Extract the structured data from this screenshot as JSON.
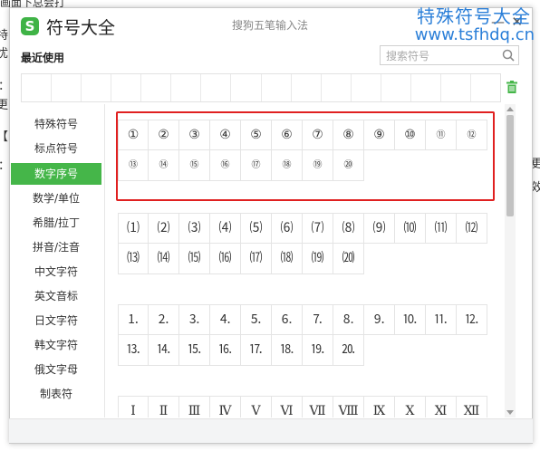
{
  "background": {
    "top_fragment": "画面下总会打",
    "left_fragments": [
      "特",
      "忧",
      "：",
      "更",
      "【",
      "："
    ],
    "right_fragments": [
      "更",
      "效"
    ]
  },
  "watermark": {
    "line1": "特殊符号大全",
    "line2": "www.tsfhdq.cn",
    "color": "#2b7fd8"
  },
  "window": {
    "title": "符号大全",
    "logo_char": "S",
    "ime_name": "搜狗五笔输入法",
    "minimize_symbol": "—",
    "close_symbol": "✕"
  },
  "recent": {
    "label": "最近使用",
    "cells": 16
  },
  "search": {
    "placeholder": "搜索符号",
    "value": ""
  },
  "categories": [
    {
      "label": "特殊符号",
      "active": false
    },
    {
      "label": "标点符号",
      "active": false
    },
    {
      "label": "数字序号",
      "active": true
    },
    {
      "label": "数学/单位",
      "active": false
    },
    {
      "label": "希腊/拉丁",
      "active": false
    },
    {
      "label": "拼音/注音",
      "active": false
    },
    {
      "label": "中文字符",
      "active": false
    },
    {
      "label": "英文音标",
      "active": false
    },
    {
      "label": "日文字符",
      "active": false
    },
    {
      "label": "韩文字符",
      "active": false
    },
    {
      "label": "俄文字母",
      "active": false
    },
    {
      "label": "制表符",
      "active": false
    }
  ],
  "symbol_groups": [
    {
      "name": "circled-numbers",
      "size": "mixed",
      "symbols": [
        "①",
        "②",
        "③",
        "④",
        "⑤",
        "⑥",
        "⑦",
        "⑧",
        "⑨",
        "⑩",
        "⑪",
        "⑫",
        "⑬",
        "⑭",
        "⑮",
        "⑯",
        "⑰",
        "⑱",
        "⑲",
        "⑳"
      ]
    },
    {
      "name": "parenthesized-numbers",
      "size": "mid",
      "symbols": [
        "⑴",
        "⑵",
        "⑶",
        "⑷",
        "⑸",
        "⑹",
        "⑺",
        "⑻",
        "⑼",
        "⑽",
        "⑾",
        "⑿",
        "⒀",
        "⒁",
        "⒂",
        "⒃",
        "⒄",
        "⒅",
        "⒆",
        "⒇"
      ]
    },
    {
      "name": "period-numbers",
      "size": "mid",
      "symbols": [
        "⒈",
        "⒉",
        "⒊",
        "⒋",
        "⒌",
        "⒍",
        "⒎",
        "⒏",
        "⒐",
        "⒑",
        "⒒",
        "⒓",
        "⒔",
        "⒕",
        "⒖",
        "⒗",
        "⒘",
        "⒙",
        "⒚",
        "⒛"
      ]
    },
    {
      "name": "roman-numerals",
      "size": "mid",
      "symbols": [
        "Ⅰ",
        "Ⅱ",
        "Ⅲ",
        "Ⅳ",
        "Ⅴ",
        "Ⅵ",
        "Ⅶ",
        "Ⅷ",
        "Ⅸ",
        "Ⅹ",
        "Ⅺ",
        "Ⅻ"
      ]
    }
  ],
  "accent_color": "#45b649",
  "highlight_color": "#e02020"
}
